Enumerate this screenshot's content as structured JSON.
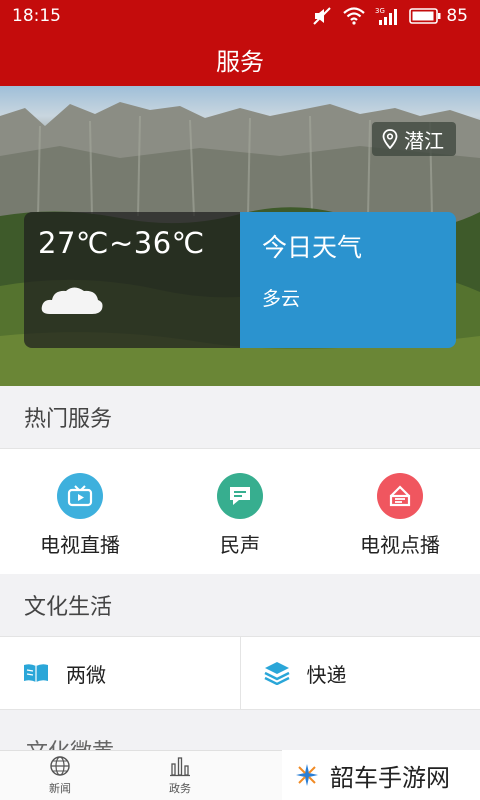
{
  "status_bar": {
    "time": "18:15",
    "battery": "85",
    "network": "3G"
  },
  "title": "服务",
  "hero": {
    "location": "潜江",
    "temperature": "27℃~36℃",
    "today_label": "今日天气",
    "condition": "多云"
  },
  "sections": {
    "hot_services": "热门服务",
    "culture": "文化生活",
    "next": "文化微黄"
  },
  "services": [
    {
      "label": "电视直播",
      "color": "#3eb0dd",
      "icon": "tv-icon"
    },
    {
      "label": "民声",
      "color": "#37ae8f",
      "icon": "chat-icon"
    },
    {
      "label": "电视点播",
      "color": "#f0565f",
      "icon": "vod-icon"
    }
  ],
  "culture_items": [
    {
      "label": "两微",
      "icon": "book-icon",
      "color": "#2aa6d8"
    },
    {
      "label": "快递",
      "icon": "box-icon",
      "color": "#2aa6d8"
    }
  ],
  "tabs": [
    {
      "label": "新闻",
      "icon": "globe-icon"
    },
    {
      "label": "政务",
      "icon": "bars-icon"
    }
  ],
  "watermark": "韶车手游网",
  "colors": {
    "primary": "#c40c0c",
    "weather_blue": "#2b93cf"
  }
}
